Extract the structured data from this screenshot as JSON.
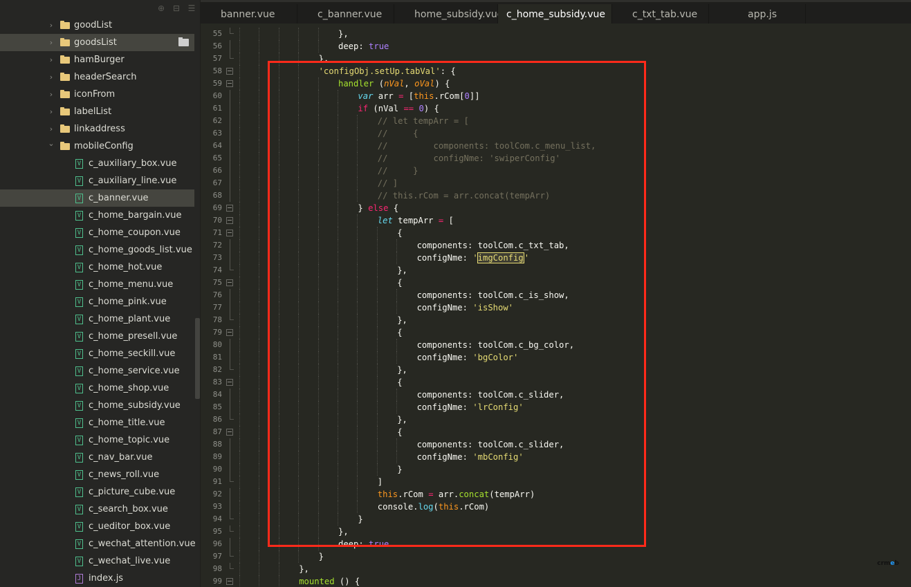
{
  "sidebar": {
    "toolbar": [
      {
        "name": "locate-icon",
        "glyph": "⊕"
      },
      {
        "name": "collapse-all-icon",
        "glyph": "⊟"
      },
      {
        "name": "menu-icon",
        "glyph": "☰"
      }
    ],
    "items": [
      {
        "label": "goodList",
        "type": "folder",
        "expanded": false,
        "depth": 1
      },
      {
        "label": "goodsList",
        "type": "folder",
        "expanded": false,
        "depth": 1,
        "selected": true
      },
      {
        "label": "hamBurger",
        "type": "folder",
        "expanded": false,
        "depth": 1
      },
      {
        "label": "headerSearch",
        "type": "folder",
        "expanded": false,
        "depth": 1
      },
      {
        "label": "iconFrom",
        "type": "folder",
        "expanded": false,
        "depth": 1
      },
      {
        "label": "labelList",
        "type": "folder",
        "expanded": false,
        "depth": 1
      },
      {
        "label": "linkaddress",
        "type": "folder",
        "expanded": false,
        "depth": 1
      },
      {
        "label": "mobileConfig",
        "type": "folder",
        "expanded": true,
        "depth": 1
      },
      {
        "label": "c_auxiliary_box.vue",
        "type": "vue",
        "depth": 2
      },
      {
        "label": "c_auxiliary_line.vue",
        "type": "vue",
        "depth": 2
      },
      {
        "label": "c_banner.vue",
        "type": "vue",
        "depth": 2,
        "selected": true
      },
      {
        "label": "c_home_bargain.vue",
        "type": "vue",
        "depth": 2
      },
      {
        "label": "c_home_coupon.vue",
        "type": "vue",
        "depth": 2
      },
      {
        "label": "c_home_goods_list.vue",
        "type": "vue",
        "depth": 2
      },
      {
        "label": "c_home_hot.vue",
        "type": "vue",
        "depth": 2
      },
      {
        "label": "c_home_menu.vue",
        "type": "vue",
        "depth": 2
      },
      {
        "label": "c_home_pink.vue",
        "type": "vue",
        "depth": 2
      },
      {
        "label": "c_home_plant.vue",
        "type": "vue",
        "depth": 2
      },
      {
        "label": "c_home_presell.vue",
        "type": "vue",
        "depth": 2
      },
      {
        "label": "c_home_seckill.vue",
        "type": "vue",
        "depth": 2
      },
      {
        "label": "c_home_service.vue",
        "type": "vue",
        "depth": 2
      },
      {
        "label": "c_home_shop.vue",
        "type": "vue",
        "depth": 2
      },
      {
        "label": "c_home_subsidy.vue",
        "type": "vue",
        "depth": 2
      },
      {
        "label": "c_home_title.vue",
        "type": "vue",
        "depth": 2
      },
      {
        "label": "c_home_topic.vue",
        "type": "vue",
        "depth": 2
      },
      {
        "label": "c_nav_bar.vue",
        "type": "vue",
        "depth": 2
      },
      {
        "label": "c_news_roll.vue",
        "type": "vue",
        "depth": 2
      },
      {
        "label": "c_picture_cube.vue",
        "type": "vue",
        "depth": 2
      },
      {
        "label": "c_search_box.vue",
        "type": "vue",
        "depth": 2
      },
      {
        "label": "c_ueditor_box.vue",
        "type": "vue",
        "depth": 2
      },
      {
        "label": "c_wechat_attention.vue",
        "type": "vue",
        "depth": 2
      },
      {
        "label": "c_wechat_live.vue",
        "type": "vue",
        "depth": 2
      },
      {
        "label": "index.js",
        "type": "js",
        "depth": 2
      }
    ]
  },
  "tabs": [
    {
      "label": "banner.vue",
      "active": false
    },
    {
      "label": "c_banner.vue",
      "active": false
    },
    {
      "label": "home_subsidy.vue",
      "active": false
    },
    {
      "label": "c_home_subsidy.vue",
      "active": true
    },
    {
      "label": "c_txt_tab.vue",
      "active": false
    },
    {
      "label": "app.js",
      "active": false
    }
  ],
  "editor": {
    "lines": [
      {
        "n": 55,
        "indent": 6,
        "fold": "end",
        "tokens": [
          [
            "",
            "},"
          ]
        ]
      },
      {
        "n": 56,
        "indent": 6,
        "fold": "line",
        "tokens": [
          [
            "",
            "deep: "
          ],
          [
            "k-bool",
            "true"
          ]
        ]
      },
      {
        "n": 57,
        "indent": 5,
        "fold": "end",
        "tokens": [
          [
            "",
            "},"
          ]
        ]
      },
      {
        "n": 58,
        "indent": 5,
        "fold": "open",
        "tokens": [
          [
            "k-str",
            "'configObj.setUp.tabVal'"
          ],
          [
            "",
            ": {"
          ]
        ]
      },
      {
        "n": 59,
        "indent": 6,
        "fold": "open",
        "tokens": [
          [
            "k-fn",
            "handler"
          ],
          [
            "",
            " ("
          ],
          [
            "k-param",
            "nVal"
          ],
          [
            "",
            ", "
          ],
          [
            "k-param",
            "oVal"
          ],
          [
            "",
            ") {"
          ]
        ]
      },
      {
        "n": 60,
        "indent": 7,
        "fold": "line",
        "tokens": [
          [
            "k-storage",
            "var"
          ],
          [
            "",
            " arr "
          ],
          [
            "k-op",
            "="
          ],
          [
            "",
            " ["
          ],
          [
            "k-this",
            "this"
          ],
          [
            "",
            ".rCom["
          ],
          [
            "k-num",
            "0"
          ],
          [
            "",
            "]]"
          ]
        ]
      },
      {
        "n": 61,
        "indent": 7,
        "fold": "line",
        "tokens": [
          [
            "k-kw",
            "if"
          ],
          [
            "",
            " (nVal "
          ],
          [
            "k-op",
            "=="
          ],
          [
            "",
            " "
          ],
          [
            "k-num",
            "0"
          ],
          [
            "",
            ") {"
          ]
        ]
      },
      {
        "n": 62,
        "indent": 8,
        "fold": "line",
        "tokens": [
          [
            "k-com",
            "// let tempArr = ["
          ]
        ]
      },
      {
        "n": 63,
        "indent": 8,
        "fold": "line",
        "tokens": [
          [
            "k-com",
            "//     {"
          ]
        ]
      },
      {
        "n": 64,
        "indent": 8,
        "fold": "line",
        "tokens": [
          [
            "k-com",
            "//         components: toolCom.c_menu_list,"
          ]
        ]
      },
      {
        "n": 65,
        "indent": 8,
        "fold": "line",
        "tokens": [
          [
            "k-com",
            "//         configNme: 'swiperConfig'"
          ]
        ]
      },
      {
        "n": 66,
        "indent": 8,
        "fold": "line",
        "tokens": [
          [
            "k-com",
            "//     }"
          ]
        ]
      },
      {
        "n": 67,
        "indent": 8,
        "fold": "line",
        "tokens": [
          [
            "k-com",
            "// ]"
          ]
        ]
      },
      {
        "n": 68,
        "indent": 8,
        "fold": "line",
        "tokens": [
          [
            "k-com",
            "// this.rCom = arr.concat(tempArr)"
          ]
        ]
      },
      {
        "n": 69,
        "indent": 7,
        "fold": "open",
        "tokens": [
          [
            "",
            "} "
          ],
          [
            "k-kw",
            "else"
          ],
          [
            "",
            " {"
          ]
        ]
      },
      {
        "n": 70,
        "indent": 8,
        "fold": "open",
        "tokens": [
          [
            "k-storage",
            "let"
          ],
          [
            "",
            " tempArr "
          ],
          [
            "k-op",
            "="
          ],
          [
            "",
            " ["
          ]
        ]
      },
      {
        "n": 71,
        "indent": 9,
        "fold": "open",
        "tokens": [
          [
            "",
            "{"
          ]
        ]
      },
      {
        "n": 72,
        "indent": 10,
        "fold": "line",
        "tokens": [
          [
            "",
            "components: toolCom.c_txt_tab,"
          ]
        ]
      },
      {
        "n": 73,
        "indent": 10,
        "fold": "line",
        "tokens": [
          [
            "",
            "configNme: "
          ],
          [
            "k-str",
            "'"
          ],
          [
            "k-str hl",
            "imgConfig"
          ],
          [
            "caret",
            ""
          ],
          [
            "k-str",
            "'"
          ]
        ]
      },
      {
        "n": 74,
        "indent": 9,
        "fold": "end",
        "tokens": [
          [
            "",
            "},"
          ]
        ]
      },
      {
        "n": 75,
        "indent": 9,
        "fold": "open",
        "tokens": [
          [
            "",
            "{"
          ]
        ]
      },
      {
        "n": 76,
        "indent": 10,
        "fold": "line",
        "tokens": [
          [
            "",
            "components: toolCom.c_is_show,"
          ]
        ]
      },
      {
        "n": 77,
        "indent": 10,
        "fold": "line",
        "tokens": [
          [
            "",
            "configNme: "
          ],
          [
            "k-str",
            "'isShow'"
          ]
        ]
      },
      {
        "n": 78,
        "indent": 9,
        "fold": "end",
        "tokens": [
          [
            "",
            "},"
          ]
        ]
      },
      {
        "n": 79,
        "indent": 9,
        "fold": "open",
        "tokens": [
          [
            "",
            "{"
          ]
        ]
      },
      {
        "n": 80,
        "indent": 10,
        "fold": "line",
        "tokens": [
          [
            "",
            "components: toolCom.c_bg_color,"
          ]
        ]
      },
      {
        "n": 81,
        "indent": 10,
        "fold": "line",
        "tokens": [
          [
            "",
            "configNme: "
          ],
          [
            "k-str",
            "'bgColor'"
          ]
        ]
      },
      {
        "n": 82,
        "indent": 9,
        "fold": "end",
        "tokens": [
          [
            "",
            "},"
          ]
        ]
      },
      {
        "n": 83,
        "indent": 9,
        "fold": "open",
        "tokens": [
          [
            "",
            "{"
          ]
        ]
      },
      {
        "n": 84,
        "indent": 10,
        "fold": "line",
        "tokens": [
          [
            "",
            "components: toolCom.c_slider,"
          ]
        ]
      },
      {
        "n": 85,
        "indent": 10,
        "fold": "line",
        "tokens": [
          [
            "",
            "configNme: "
          ],
          [
            "k-str",
            "'lrConfig'"
          ]
        ]
      },
      {
        "n": 86,
        "indent": 9,
        "fold": "end",
        "tokens": [
          [
            "",
            "},"
          ]
        ]
      },
      {
        "n": 87,
        "indent": 9,
        "fold": "open",
        "tokens": [
          [
            "",
            "{"
          ]
        ]
      },
      {
        "n": 88,
        "indent": 10,
        "fold": "line",
        "tokens": [
          [
            "",
            "components: toolCom.c_slider,"
          ]
        ]
      },
      {
        "n": 89,
        "indent": 10,
        "fold": "line",
        "tokens": [
          [
            "",
            "configNme: "
          ],
          [
            "k-str",
            "'mbConfig'"
          ]
        ]
      },
      {
        "n": 90,
        "indent": 9,
        "fold": "line",
        "tokens": [
          [
            "",
            "}"
          ]
        ]
      },
      {
        "n": 91,
        "indent": 8,
        "fold": "end",
        "tokens": [
          [
            "",
            "]"
          ]
        ]
      },
      {
        "n": 92,
        "indent": 8,
        "fold": "line",
        "tokens": [
          [
            "k-this",
            "this"
          ],
          [
            "",
            ".rCom "
          ],
          [
            "k-op",
            "="
          ],
          [
            "",
            " arr."
          ],
          [
            "k-fn",
            "concat"
          ],
          [
            "",
            "(tempArr)"
          ]
        ]
      },
      {
        "n": 93,
        "indent": 8,
        "fold": "line",
        "tokens": [
          [
            "",
            "console."
          ],
          [
            "k-sup",
            "log"
          ],
          [
            "",
            "("
          ],
          [
            "k-this",
            "this"
          ],
          [
            "",
            ".rCom)"
          ]
        ]
      },
      {
        "n": 94,
        "indent": 7,
        "fold": "end",
        "tokens": [
          [
            "",
            "}"
          ]
        ]
      },
      {
        "n": 95,
        "indent": 6,
        "fold": "end",
        "tokens": [
          [
            "",
            "},"
          ]
        ]
      },
      {
        "n": 96,
        "indent": 6,
        "fold": "line",
        "tokens": [
          [
            "",
            "deep: "
          ],
          [
            "k-bool",
            "true"
          ]
        ]
      },
      {
        "n": 97,
        "indent": 5,
        "fold": "end",
        "tokens": [
          [
            "",
            "}"
          ]
        ]
      },
      {
        "n": 98,
        "indent": 4,
        "fold": "end",
        "tokens": [
          [
            "",
            "},"
          ]
        ]
      },
      {
        "n": 99,
        "indent": 4,
        "fold": "open",
        "tokens": [
          [
            "k-fn",
            "mounted"
          ],
          [
            "",
            " () {"
          ]
        ]
      }
    ]
  },
  "colors": {
    "annotation_box": "#ff2a1a",
    "editor_bg": "#272822",
    "sidebar_bg": "#262624"
  },
  "watermark": {
    "prefix": "crm",
    "accent": "e",
    "suffix": "b"
  }
}
